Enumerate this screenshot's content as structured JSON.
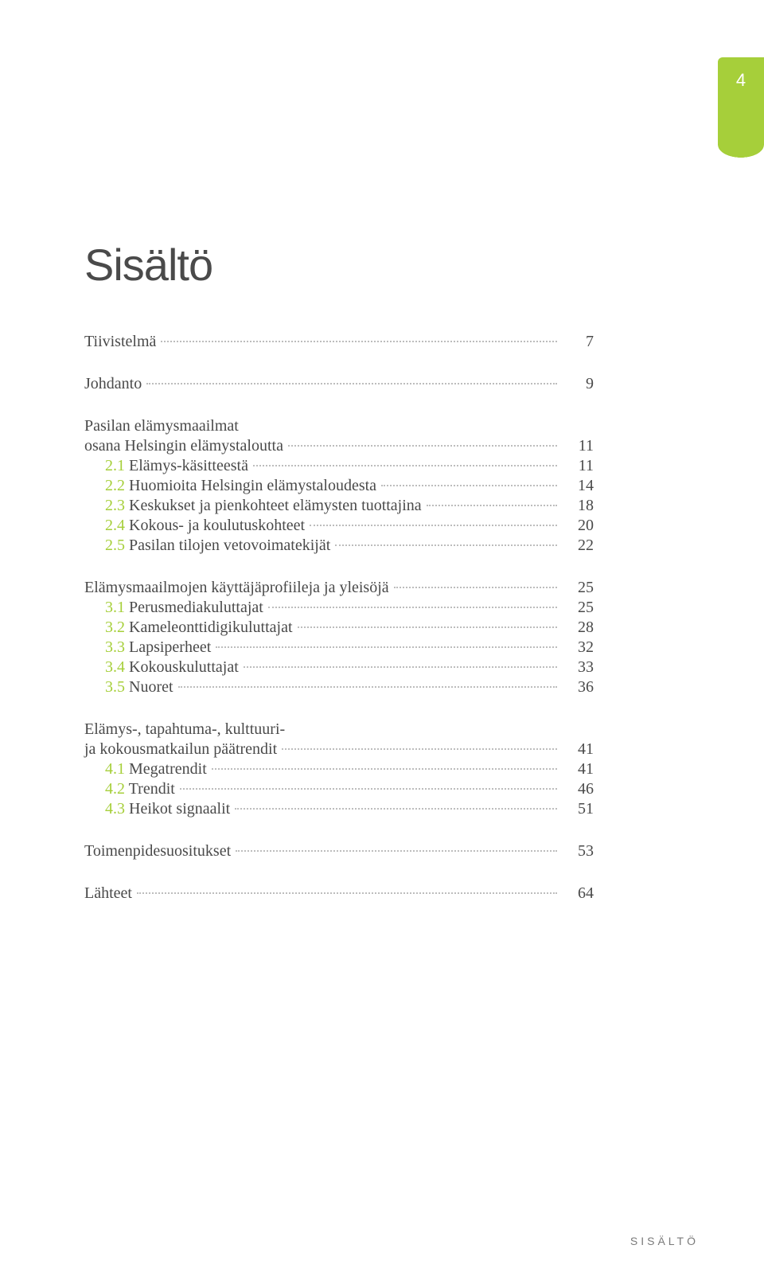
{
  "page_marker": "4",
  "title": "Sisältö",
  "footer": "SISÄLTÖ",
  "toc": {
    "tiivistelma": {
      "label": "Tiivistelmä",
      "page": "7"
    },
    "johdanto": {
      "label": "Johdanto",
      "page": "9"
    },
    "section2": {
      "heading_line1": "Pasilan elämysmaailmat",
      "heading_line2": "osana Helsingin elämystaloutta",
      "page": "11",
      "s1": {
        "num": "2.1",
        "label": " Elämys-käsitteestä",
        "page": "11"
      },
      "s2": {
        "num": "2.2",
        "label": " Huomioita Helsingin elämystaloudesta",
        "page": "14"
      },
      "s3": {
        "num": "2.3",
        "label": " Keskukset ja pienkohteet elämysten tuottajina",
        "page": "18"
      },
      "s4": {
        "num": "2.4",
        "label": " Kokous- ja koulutuskohteet",
        "page": "20"
      },
      "s5": {
        "num": "2.5",
        "label": " Pasilan tilojen vetovoimatekijät",
        "page": "22"
      }
    },
    "section3": {
      "heading": "Elämysmaailmojen käyttäjäprofiileja ja yleisöjä",
      "page": "25",
      "s1": {
        "num": "3.1",
        "label": " Perusmediakuluttajat",
        "page": "25"
      },
      "s2": {
        "num": "3.2",
        "label": " Kameleonttidigikuluttajat",
        "page": "28"
      },
      "s3": {
        "num": "3.3",
        "label": " Lapsiperheet",
        "page": "32"
      },
      "s4": {
        "num": "3.4",
        "label": " Kokouskuluttajat",
        "page": "33"
      },
      "s5": {
        "num": "3.5",
        "label": " Nuoret",
        "page": "36"
      }
    },
    "section4": {
      "heading_line1": "Elämys-, tapahtuma-, kulttuuri-",
      "heading_line2": "ja kokousmatkailun päätrendit",
      "page": "41",
      "s1": {
        "num": "4.1",
        "label": " Megatrendit",
        "page": "41"
      },
      "s2": {
        "num": "4.2",
        "label": " Trendit",
        "page": "46"
      },
      "s3": {
        "num": "4.3",
        "label": " Heikot signaalit",
        "page": "51"
      }
    },
    "toimen": {
      "label": "Toimenpidesuositukset",
      "page": "53"
    },
    "lahteet": {
      "label": "Lähteet",
      "page": "64"
    }
  }
}
